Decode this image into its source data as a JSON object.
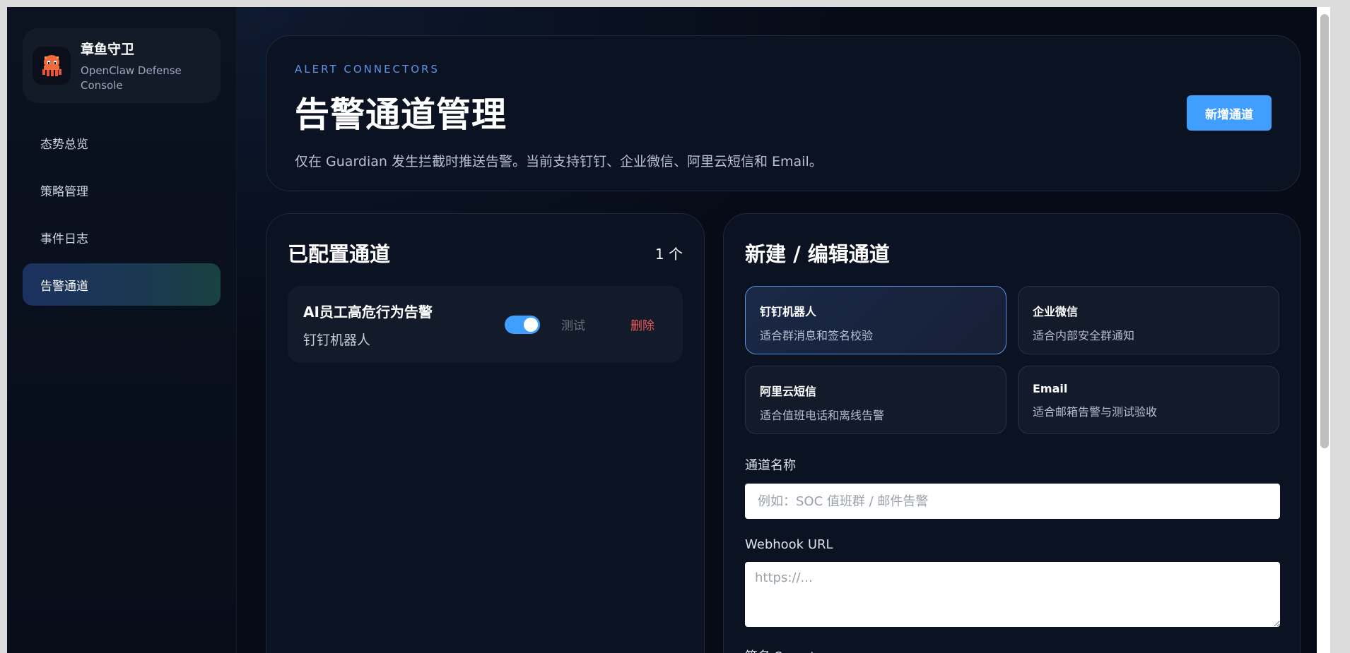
{
  "brand": {
    "title": "章鱼守卫",
    "subtitle": "OpenClaw Defense Console",
    "logo_icon": "octopus-icon",
    "accent_color": "#409eff"
  },
  "sidebar": {
    "items": [
      {
        "label": "态势总览",
        "active": false
      },
      {
        "label": "策略管理",
        "active": false
      },
      {
        "label": "事件日志",
        "active": false
      },
      {
        "label": "告警通道",
        "active": true
      }
    ]
  },
  "hero": {
    "eyebrow": "ALERT CONNECTORS",
    "title": "告警通道管理",
    "description": "仅在 Guardian 发生拦截时推送告警。当前支持钉钉、企业微信、阿里云短信和 Email。",
    "add_button": "新增通道"
  },
  "configured": {
    "title": "已配置通道",
    "count": "1 个",
    "channels": [
      {
        "name": "AI员工高危行为告警",
        "type": "钉钉机器人",
        "enabled": true,
        "test_label": "测试",
        "delete_label": "删除"
      }
    ]
  },
  "editor": {
    "title": "新建 / 编辑通道",
    "types": [
      {
        "name": "钉钉机器人",
        "desc": "适合群消息和签名校验",
        "selected": true
      },
      {
        "name": "企业微信",
        "desc": "适合内部安全群通知",
        "selected": false
      },
      {
        "name": "阿里云短信",
        "desc": "适合值班电话和离线告警",
        "selected": false
      },
      {
        "name": "Email",
        "desc": "适合邮箱告警与测试验收",
        "selected": false
      }
    ],
    "name_label": "通道名称",
    "name_placeholder": "例如：SOC 值班群 / 邮件告警",
    "webhook_label": "Webhook URL",
    "webhook_placeholder": "https://...",
    "secret_label": "签名 Secret"
  }
}
